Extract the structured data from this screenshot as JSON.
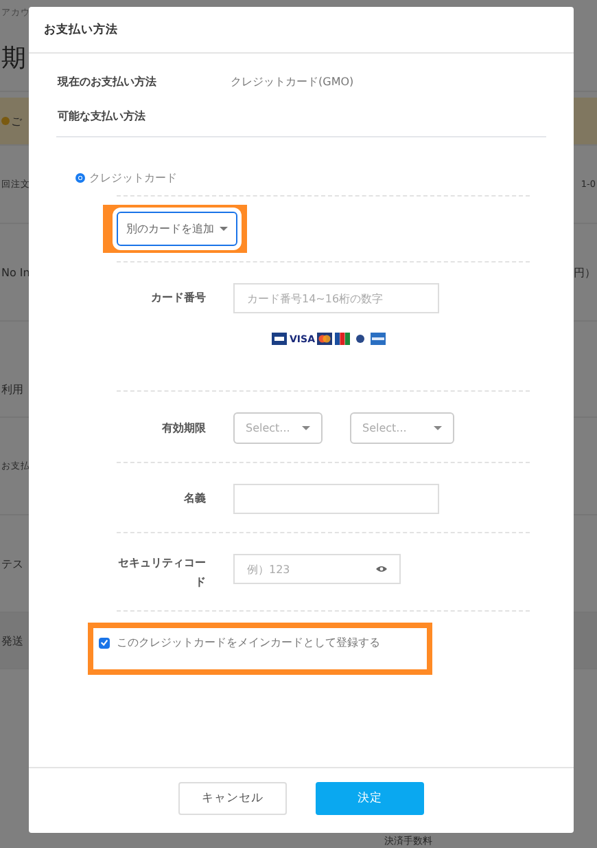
{
  "background": {
    "rows": [
      {
        "kind": "crumb",
        "left": "アカウ"
      },
      {
        "kind": "title",
        "left": "期"
      },
      {
        "kind": "notice",
        "left": "ご"
      },
      {
        "kind": "plain",
        "left": "回注文",
        "right": "1-0"
      },
      {
        "kind": "plain",
        "left": "No In",
        "right": "円）"
      },
      {
        "kind": "plain",
        "left": "利用"
      },
      {
        "kind": "plain",
        "left": "お支払"
      },
      {
        "kind": "plain",
        "left": "テス"
      },
      {
        "kind": "band",
        "left": "発送"
      }
    ],
    "footer_text": "決済手数料"
  },
  "dialog": {
    "title": "お支払い方法",
    "current_label": "現在のお支払い方法",
    "current_value": "クレジットカード(GMO)",
    "available_heading": "可能な支払い方法",
    "methods": [
      {
        "label": "クレジットカード",
        "selected": true
      }
    ],
    "card_dropdown": {
      "label": "別のカードを追加",
      "highlighted": true
    },
    "fields": [
      {
        "kind": "text",
        "label": "カード番号",
        "placeholder": "カード番号14~16桁の数字",
        "brands": [
          {
            "kind": "diners"
          },
          {
            "kind": "visa",
            "text": "VISA"
          },
          {
            "kind": "master"
          },
          {
            "kind": "jcb"
          },
          {
            "kind": "discover"
          },
          {
            "kind": "amex"
          }
        ]
      },
      {
        "kind": "selects",
        "label": "有効期限",
        "selects": [
          "Select...",
          "Select..."
        ]
      },
      {
        "kind": "text",
        "label": "名義"
      },
      {
        "kind": "secret",
        "label": "セキュリティコード",
        "placeholder": "例）123"
      }
    ],
    "main_card": {
      "label": "このクレジットカードをメインカードとして登録する",
      "checked": true,
      "highlighted": true
    },
    "buttons": [
      {
        "label": "キャンセル",
        "kind": "secondary"
      },
      {
        "label": "決定",
        "kind": "primary"
      }
    ]
  }
}
